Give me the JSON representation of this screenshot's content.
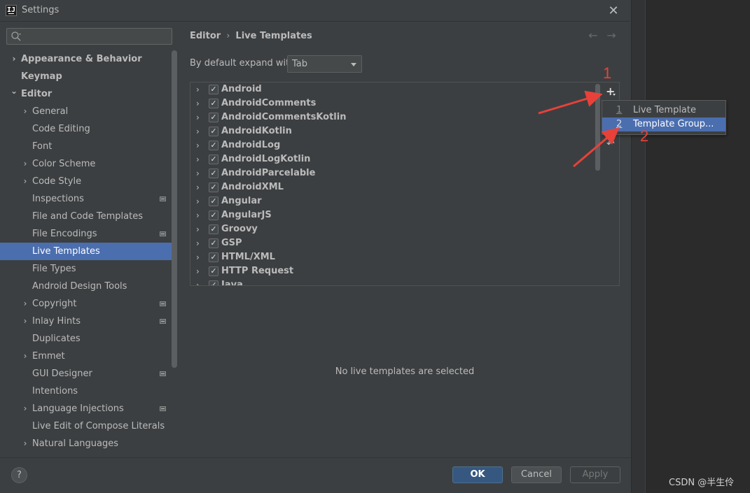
{
  "window": {
    "title": "Settings",
    "app_icon_text": "IJ"
  },
  "search": {
    "placeholder": ""
  },
  "sidebar": {
    "items": [
      {
        "label": "Appearance & Behavior",
        "level": 0,
        "expandable": true,
        "expanded": false,
        "bold": true,
        "badge": false,
        "selected": false
      },
      {
        "label": "Keymap",
        "level": 0,
        "expandable": false,
        "bold": true,
        "badge": false,
        "selected": false
      },
      {
        "label": "Editor",
        "level": 0,
        "expandable": true,
        "expanded": true,
        "bold": true,
        "badge": false,
        "selected": false
      },
      {
        "label": "General",
        "level": 1,
        "expandable": true,
        "expanded": false,
        "bold": false,
        "badge": false,
        "selected": false
      },
      {
        "label": "Code Editing",
        "level": 1,
        "expandable": false,
        "bold": false,
        "badge": false,
        "selected": false
      },
      {
        "label": "Font",
        "level": 1,
        "expandable": false,
        "bold": false,
        "badge": false,
        "selected": false
      },
      {
        "label": "Color Scheme",
        "level": 1,
        "expandable": true,
        "expanded": false,
        "bold": false,
        "badge": false,
        "selected": false
      },
      {
        "label": "Code Style",
        "level": 1,
        "expandable": true,
        "expanded": false,
        "bold": false,
        "badge": false,
        "selected": false
      },
      {
        "label": "Inspections",
        "level": 1,
        "expandable": false,
        "bold": false,
        "badge": true,
        "selected": false
      },
      {
        "label": "File and Code Templates",
        "level": 1,
        "expandable": false,
        "bold": false,
        "badge": false,
        "selected": false
      },
      {
        "label": "File Encodings",
        "level": 1,
        "expandable": false,
        "bold": false,
        "badge": true,
        "selected": false
      },
      {
        "label": "Live Templates",
        "level": 1,
        "expandable": false,
        "bold": false,
        "badge": false,
        "selected": true
      },
      {
        "label": "File Types",
        "level": 1,
        "expandable": false,
        "bold": false,
        "badge": false,
        "selected": false
      },
      {
        "label": "Android Design Tools",
        "level": 1,
        "expandable": false,
        "bold": false,
        "badge": false,
        "selected": false
      },
      {
        "label": "Copyright",
        "level": 1,
        "expandable": true,
        "expanded": false,
        "bold": false,
        "badge": true,
        "selected": false
      },
      {
        "label": "Inlay Hints",
        "level": 1,
        "expandable": true,
        "expanded": false,
        "bold": false,
        "badge": true,
        "selected": false
      },
      {
        "label": "Duplicates",
        "level": 1,
        "expandable": false,
        "bold": false,
        "badge": false,
        "selected": false
      },
      {
        "label": "Emmet",
        "level": 1,
        "expandable": true,
        "expanded": false,
        "bold": false,
        "badge": false,
        "selected": false
      },
      {
        "label": "GUI Designer",
        "level": 1,
        "expandable": false,
        "bold": false,
        "badge": true,
        "selected": false
      },
      {
        "label": "Intentions",
        "level": 1,
        "expandable": false,
        "bold": false,
        "badge": false,
        "selected": false
      },
      {
        "label": "Language Injections",
        "level": 1,
        "expandable": true,
        "expanded": false,
        "bold": false,
        "badge": true,
        "selected": false
      },
      {
        "label": "Live Edit of Compose Literals",
        "level": 1,
        "expandable": false,
        "bold": false,
        "badge": false,
        "selected": false
      },
      {
        "label": "Natural Languages",
        "level": 1,
        "expandable": true,
        "expanded": false,
        "bold": false,
        "badge": false,
        "selected": false
      }
    ]
  },
  "main": {
    "breadcrumb": [
      "Editor",
      "Live Templates"
    ],
    "breadcrumb_separator": "›",
    "expand_label": "By default expand with",
    "expand_value": "Tab",
    "templates": [
      {
        "label": "Android",
        "checked": true
      },
      {
        "label": "AndroidComments",
        "checked": true
      },
      {
        "label": "AndroidCommentsKotlin",
        "checked": true
      },
      {
        "label": "AndroidKotlin",
        "checked": true
      },
      {
        "label": "AndroidLog",
        "checked": true
      },
      {
        "label": "AndroidLogKotlin",
        "checked": true
      },
      {
        "label": "AndroidParcelable",
        "checked": true
      },
      {
        "label": "AndroidXML",
        "checked": true
      },
      {
        "label": "Angular",
        "checked": true
      },
      {
        "label": "AngularJS",
        "checked": true
      },
      {
        "label": "Groovy",
        "checked": true
      },
      {
        "label": "GSP",
        "checked": true
      },
      {
        "label": "HTML/XML",
        "checked": true
      },
      {
        "label": "HTTP Request",
        "checked": true
      },
      {
        "label": "Java",
        "checked": true
      }
    ],
    "empty_message": "No live templates are selected"
  },
  "popup_menu": {
    "items": [
      {
        "number": "1",
        "label": "Live Template",
        "selected": false
      },
      {
        "number": "2",
        "label": "Template Group...",
        "selected": true
      }
    ]
  },
  "annotations": {
    "marker_1": "1",
    "marker_2": "2",
    "color": "#e8413a"
  },
  "footer": {
    "help_label": "?",
    "ok_label": "OK",
    "cancel_label": "Cancel",
    "apply_label": "Apply"
  },
  "watermark": "CSDN @半生伶",
  "icons": {
    "close": "close-icon",
    "search": "search-icon",
    "add": "add-icon",
    "undo": "undo-icon",
    "back": "arrow-left-icon",
    "forward": "arrow-right-icon"
  },
  "colors": {
    "selection": "#4b6eaf",
    "ok_button": "#365880",
    "background": "#3c3f41"
  }
}
